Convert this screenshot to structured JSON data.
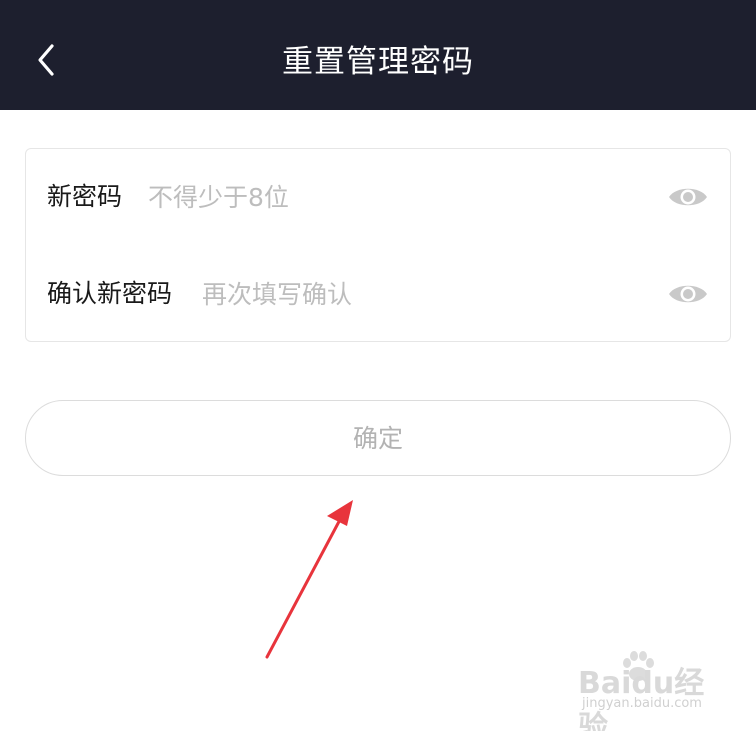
{
  "header": {
    "back_icon": "chevron-left-icon",
    "title": "重置管理密码"
  },
  "form": {
    "new_password": {
      "label": "新密码",
      "placeholder": "不得少于8位",
      "value": "",
      "toggle_icon": "eye-icon"
    },
    "confirm_password": {
      "label": "确认新密码",
      "placeholder": "再次填写确认",
      "value": "",
      "toggle_icon": "eye-icon"
    }
  },
  "actions": {
    "confirm_label": "确定"
  },
  "watermark": {
    "brand": "Baidu经验",
    "url": "jingyan.baidu.com"
  },
  "colors": {
    "header_bg": "#1d1f2e",
    "arrow": "#e8343c",
    "placeholder": "#bdbdbd",
    "button_text": "#b3b3b3"
  }
}
